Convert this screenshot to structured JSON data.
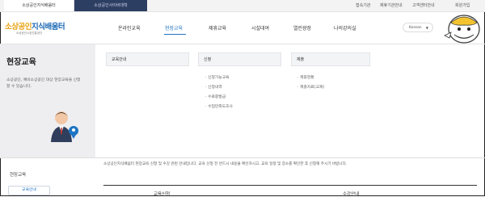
{
  "topbar": {
    "site_tabs": [
      {
        "label": "소상공인지식배움터"
      },
      {
        "label": "소상공인사이버대학"
      }
    ],
    "utility_links": [
      {
        "label": "접속기관"
      },
      {
        "label": "제휴기관안내"
      },
      {
        "label": "고객센터안내"
      },
      {
        "label": "회원가입"
      }
    ]
  },
  "header": {
    "logo_part1": "소상공인",
    "logo_part2": "지식배움터",
    "logo_sub": "소상공인시장진흥공단",
    "nav": [
      {
        "label": "온라인교육"
      },
      {
        "label": "현장교육"
      },
      {
        "label": "제휴교육"
      },
      {
        "label": "시설대여"
      },
      {
        "label": "열린광장"
      },
      {
        "label": "나의강의실"
      }
    ],
    "language_select": "Korean"
  },
  "mega_menu": {
    "title": "현장교육",
    "description": "소상공인, 예비소상공인 대상 현장교육을 신청할 수 있습니다.",
    "columns": [
      {
        "head": "교육안내",
        "items": []
      },
      {
        "head": "신청",
        "items": [
          "신청가능교육",
          "신청내역",
          "수료증발급",
          "수업만족도조사"
        ]
      },
      {
        "head": "제출",
        "items": [
          "제출현황",
          "제출자료(교재)"
        ]
      }
    ]
  },
  "content": {
    "notice": "소상공인지식배움터 현장교육 신청 및 수강 관련 안내입니다. 교육 신청 전 반드시 내용을 확인하시고, 교육 일정 및 장소를 확인한 후 신청해 주시기 바랍니다.",
    "sidebar_heading": "현장교육",
    "sidebar_box": "교육안내",
    "bottom_label_1": "교육신청",
    "bottom_label_2": "수강안내"
  },
  "colors": {
    "accent": "#1f74c3",
    "logo_yellow": "#e8a317",
    "panel_bg": "#eeeef0",
    "topbar_dark": "#2d3e63"
  }
}
